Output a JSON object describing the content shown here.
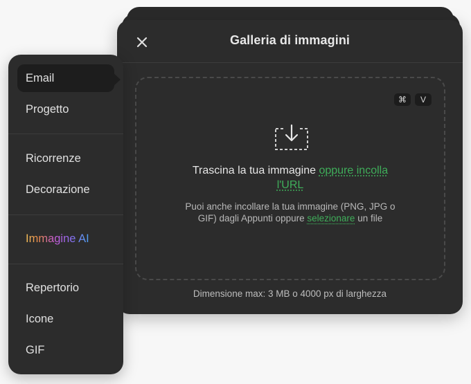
{
  "modal": {
    "title": "Galleria di immagini",
    "shortcut_keys": [
      "⌘",
      "V"
    ],
    "drop_main_text": "Trascina la tua immagine",
    "drop_main_link": "oppure incolla l'URL",
    "drop_sub_text": "Puoi anche incollare la tua immagine (PNG, JPG o GIF) dagli Appunti oppure",
    "drop_sub_link": "selezionare",
    "drop_sub_tail": "un file",
    "footer_note": "Dimensione max: 3 MB o 4000 px di larghezza",
    "accent_color": "#3fae5a"
  },
  "menu": {
    "items": [
      {
        "label": "Email",
        "active": true
      },
      {
        "label": "Progetto"
      },
      {
        "label": "Ricorrenze"
      },
      {
        "label": "Decorazione"
      },
      {
        "label": "Immagine AI"
      },
      {
        "label": "Repertorio"
      },
      {
        "label": "Icone"
      },
      {
        "label": "GIF"
      }
    ]
  },
  "icons": {
    "close": "close-icon",
    "drop": "download-tray-icon"
  }
}
